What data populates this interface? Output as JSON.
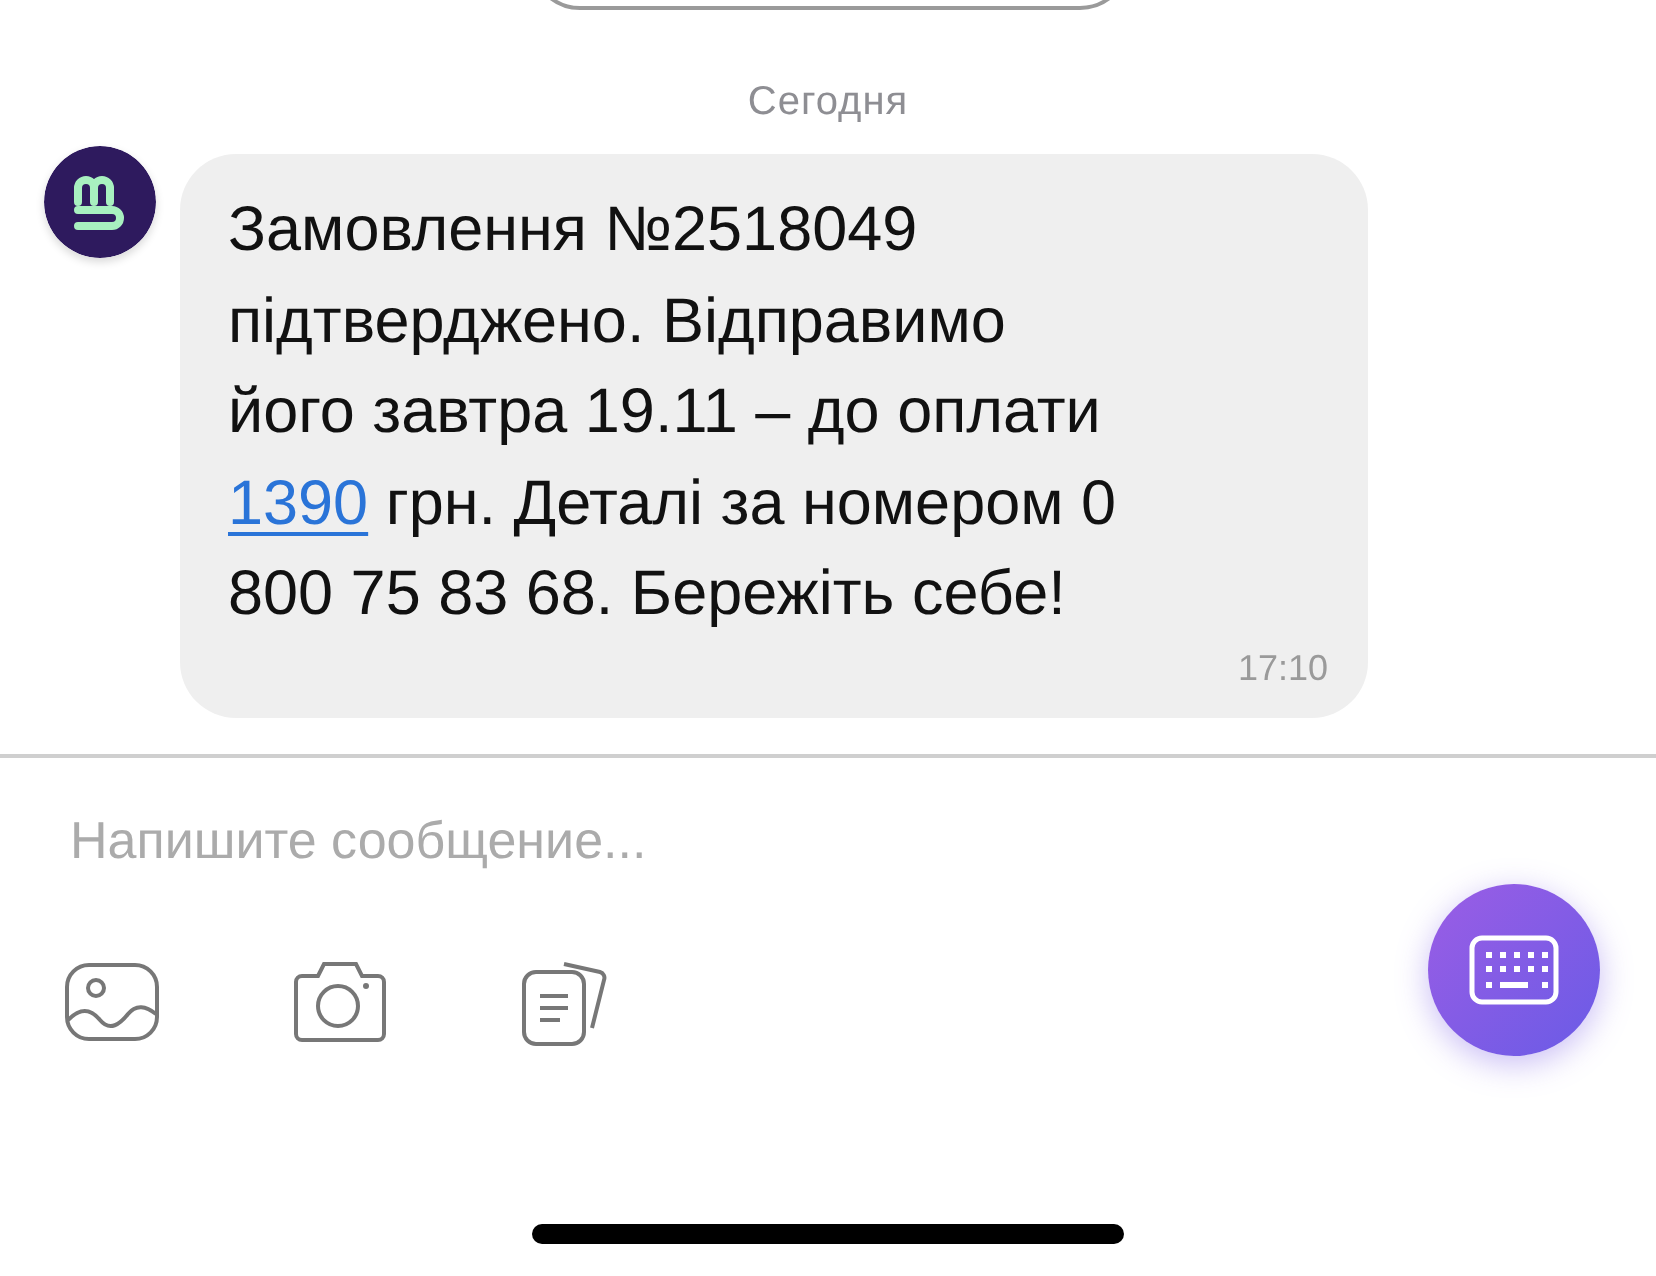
{
  "date_separator": "Сегодня",
  "message": {
    "lines": [
      [
        {
          "kind": "plain",
          "text": "Замовлення №2518049"
        }
      ],
      [
        {
          "kind": "plain",
          "text": "підтверджено. Відправимо"
        }
      ],
      [
        {
          "kind": "plain",
          "text": "його завтра 19.11 – до оплати"
        }
      ],
      [
        {
          "kind": "link",
          "text": "1390"
        },
        {
          "kind": "plain",
          "text": " грн. Деталі за номером 0"
        }
      ],
      [
        {
          "kind": "plain",
          "text": "800 75 83 68. Бережіть себе!"
        }
      ]
    ],
    "time": "17:10"
  },
  "composer": {
    "placeholder": "Напишите сообщение..."
  }
}
